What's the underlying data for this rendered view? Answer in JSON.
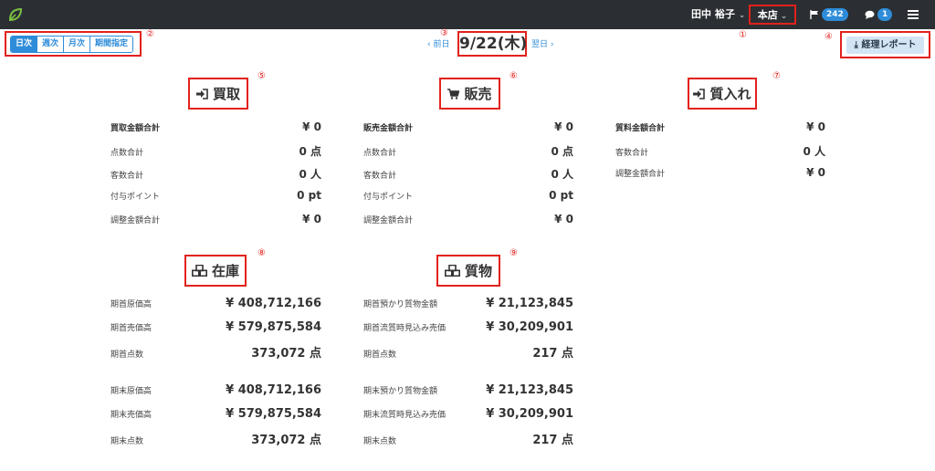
{
  "header": {
    "user_name": "田中 裕子",
    "store_name": "本店",
    "flag_count": "242",
    "chat_count": "1"
  },
  "annotations": [
    "①",
    "②",
    "③",
    "④",
    "⑤",
    "⑥",
    "⑦",
    "⑧",
    "⑨"
  ],
  "period_tabs": [
    "日次",
    "週次",
    "月次",
    "期間指定"
  ],
  "date_nav": {
    "prev": "‹ 前日",
    "current": "9/22(木)",
    "next": "翌日 ›"
  },
  "report_button": "経理レポート",
  "panels": {
    "kaitori": {
      "title": "買取",
      "rows": [
        {
          "label": "買取金額合計",
          "value": "¥ 0"
        },
        {
          "label": "点数合計",
          "value": "0 点"
        },
        {
          "label": "客数合計",
          "value": "0 人"
        },
        {
          "label": "付与ポイント",
          "value": "0 pt"
        },
        {
          "label": "調整金額合計",
          "value": "¥ 0"
        }
      ]
    },
    "hanbai": {
      "title": "販売",
      "rows": [
        {
          "label": "販売金額合計",
          "value": "¥ 0"
        },
        {
          "label": "点数合計",
          "value": "0 点"
        },
        {
          "label": "客数合計",
          "value": "0 人"
        },
        {
          "label": "付与ポイント",
          "value": "0 pt"
        },
        {
          "label": "調整金額合計",
          "value": "¥ 0"
        }
      ]
    },
    "shichiire": {
      "title": "質入れ",
      "rows": [
        {
          "label": "質料金額合計",
          "value": "¥ 0"
        },
        {
          "label": "客数合計",
          "value": "0 人"
        },
        {
          "label": "調整金額合計",
          "value": "¥ 0"
        }
      ]
    },
    "zaiko": {
      "title": "在庫",
      "start_rows": [
        {
          "label": "期首原価高",
          "value": "¥ 408,712,166"
        },
        {
          "label": "期首売価高",
          "value": "¥ 579,875,584"
        },
        {
          "label": "期首点数",
          "value": "373,072 点"
        }
      ],
      "end_rows": [
        {
          "label": "期末原価高",
          "value": "¥ 408,712,166"
        },
        {
          "label": "期末売価高",
          "value": "¥ 579,875,584"
        },
        {
          "label": "期末点数",
          "value": "373,072 点"
        }
      ]
    },
    "shichimotsu": {
      "title": "質物",
      "start_rows": [
        {
          "label": "期首預かり質物金額",
          "value": "¥ 21,123,845"
        },
        {
          "label": "期首流質時見込み売価",
          "value": "¥ 30,209,901"
        },
        {
          "label": "期首点数",
          "value": "217 点"
        }
      ],
      "end_rows": [
        {
          "label": "期末預かり質物金額",
          "value": "¥ 21,123,845"
        },
        {
          "label": "期末流質時見込み売価",
          "value": "¥ 30,209,901"
        },
        {
          "label": "期末点数",
          "value": "217 点"
        }
      ]
    }
  },
  "colors": {
    "topbar": "#2b2f33",
    "accent": "#2e8cd9",
    "annotation": "#e2211c"
  }
}
